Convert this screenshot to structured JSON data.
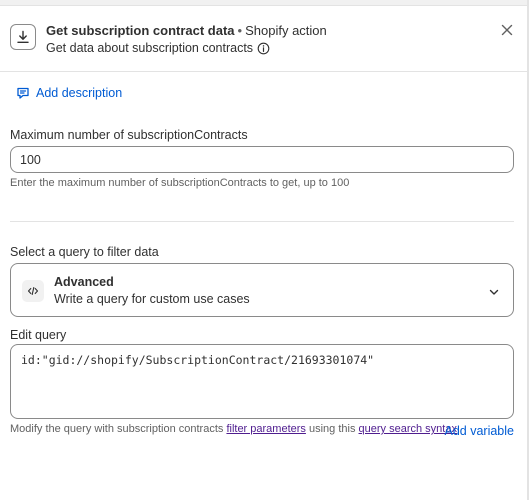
{
  "header": {
    "title": "Get subscription contract data",
    "separator": "•",
    "type_label": "Shopify action",
    "subtitle": "Get data about subscription contracts"
  },
  "add_description": "Add description",
  "max_field": {
    "label": "Maximum number of subscriptionContracts",
    "value": "100",
    "help": "Enter the maximum number of subscriptionContracts to get, up to 100"
  },
  "query_select": {
    "label": "Select a query to filter data",
    "selected_title": "Advanced",
    "selected_subtitle": "Write a query for custom use cases"
  },
  "edit_query": {
    "label": "Edit query",
    "value": "id:\"gid://shopify/SubscriptionContract/21693301074\"",
    "help_prefix": "Modify the query with subscription contracts ",
    "help_link1": "filter parameters",
    "help_middle": " using this ",
    "help_link2": "query search syntax",
    "help_suffix": ".",
    "add_variable": "Add variable"
  },
  "colors": {
    "link_blue": "#005bd3",
    "visited_link": "#4f1d8f",
    "text": "#303030",
    "muted": "#616161",
    "border": "#8a8a8a"
  },
  "icons": {
    "header": "download-icon",
    "info": "info-icon",
    "close": "close-icon",
    "description": "comment-icon",
    "code": "code-icon",
    "chevron": "chevron-down-icon"
  }
}
